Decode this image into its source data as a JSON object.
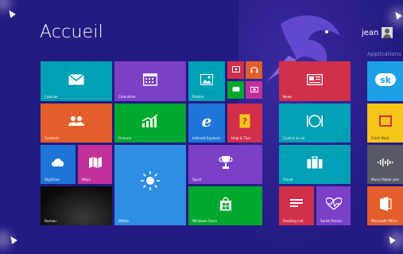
{
  "header": {
    "title": "Accueil",
    "user": "jean",
    "apps_label": "Applications A"
  },
  "tiles": {
    "courrier": "Courrier",
    "calendrier": "Calendrier",
    "photos": "Photos",
    "news": "News",
    "contacts": "Contacts",
    "finance": "Finance",
    "ie": "Internet Explorer",
    "help": "Help & Tips",
    "cuisine": "Cuisine & vin",
    "skydrive": "SkyDrive",
    "maps": "Maps",
    "meteo": "Météo",
    "sport": "Sport",
    "travel": "Travel",
    "bureau": "Bureau",
    "store": "Windows Store",
    "reading": "Reading List",
    "sante": "Santé  fitness",
    "fresh": "Fresh Paint",
    "musicmaker": "Music Maker Jam",
    "office": "Microsoft Office"
  },
  "colors": {
    "background": "#231a82",
    "teal": "#00a0b4",
    "purple": "#7b3fc8",
    "green": "#00a82d",
    "orange": "#e25f2b",
    "blue": "#1e74d8",
    "red": "#d12f4a"
  }
}
